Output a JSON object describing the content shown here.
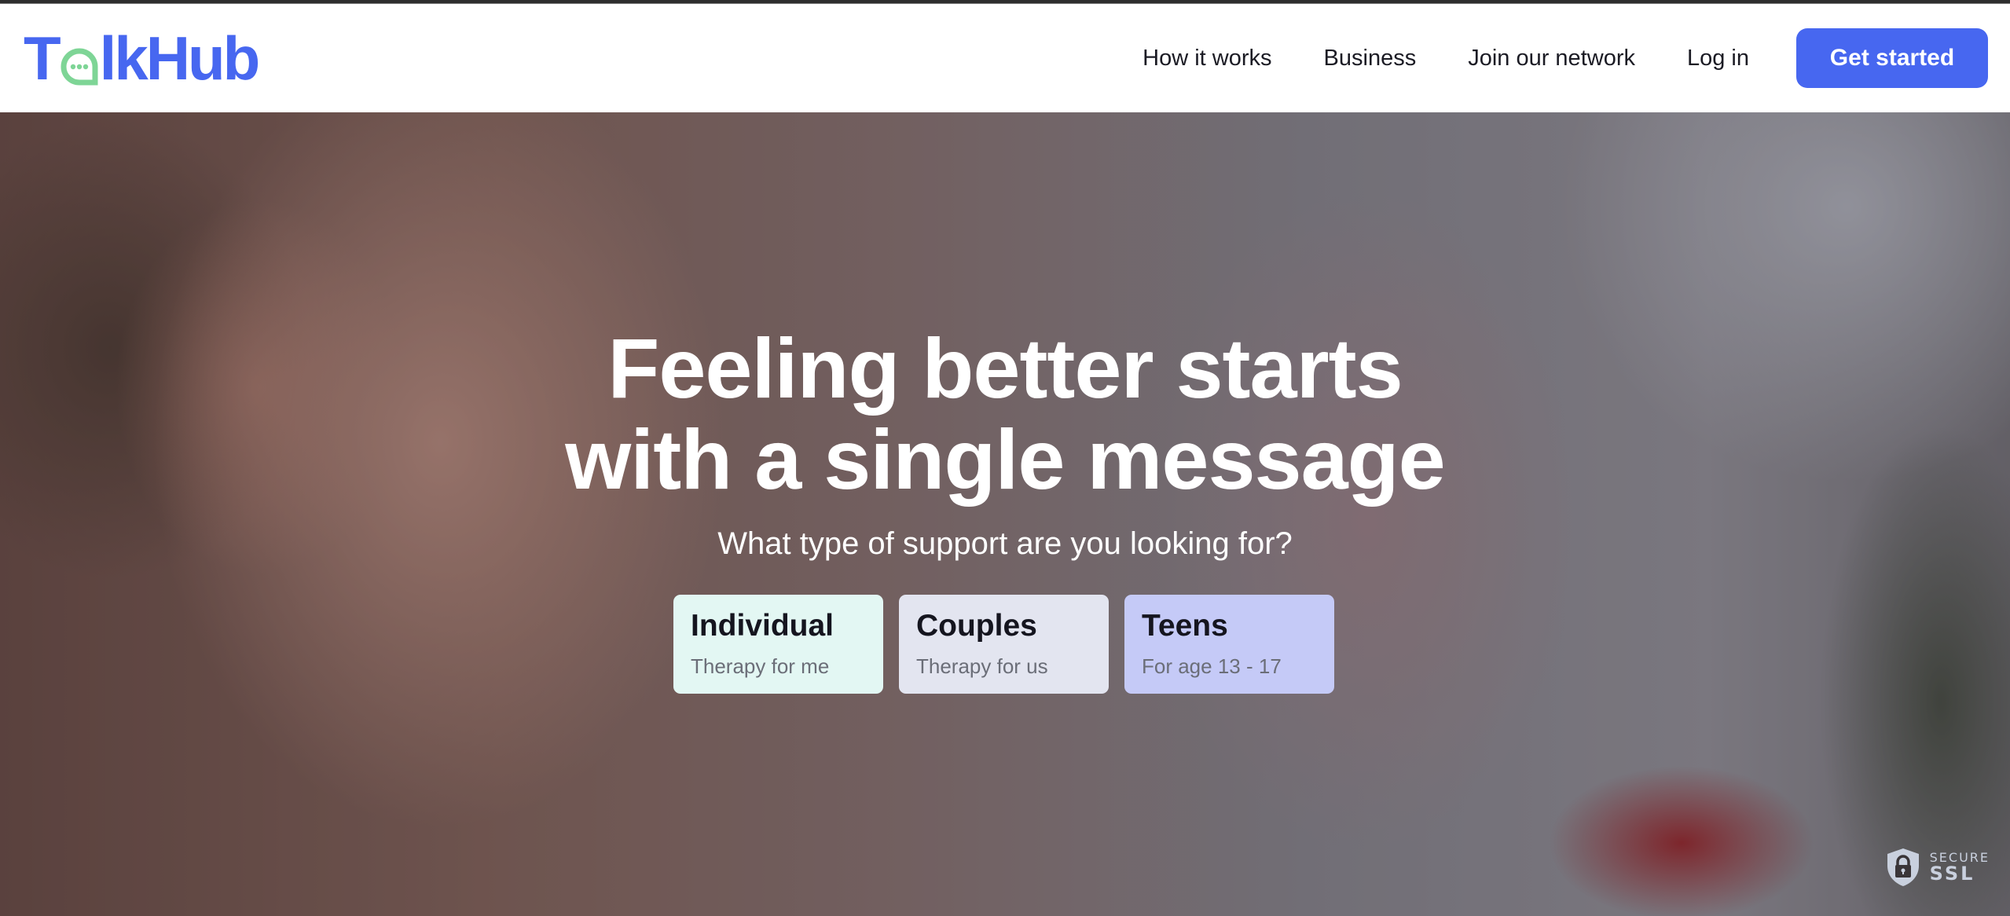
{
  "brand": {
    "name_prefix": "T",
    "name_suffix": "lkHub",
    "full_name": "TalkHub",
    "primary_color": "#4767f0",
    "accent_color": "#7ed596"
  },
  "nav": {
    "links": [
      {
        "label": "How it works"
      },
      {
        "label": "Business"
      },
      {
        "label": "Join our network"
      },
      {
        "label": "Log in"
      }
    ],
    "cta_label": "Get started"
  },
  "hero": {
    "headline_line1": "Feeling better starts",
    "headline_line2": "with a single message",
    "subtitle": "What type of support are you looking for?",
    "cards": [
      {
        "title": "Individual",
        "subtitle": "Therapy for me",
        "color": "#e3f7f3"
      },
      {
        "title": "Couples",
        "subtitle": "Therapy for us",
        "color": "#e3e5f0"
      },
      {
        "title": "Teens",
        "subtitle": "For age 13 - 17",
        "color": "#c5caf7"
      }
    ]
  },
  "badge": {
    "line1": "SECURE",
    "line2": "SSL",
    "icon": "shield-lock-icon"
  }
}
